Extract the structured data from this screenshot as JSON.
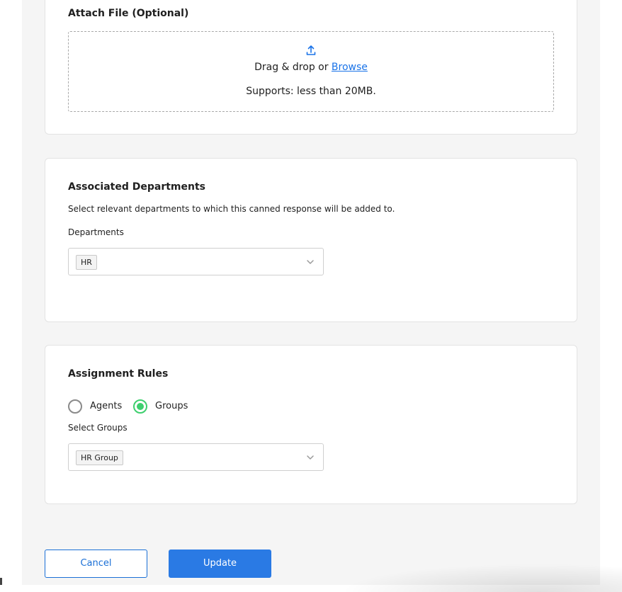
{
  "attach": {
    "title": "Attach File (Optional)",
    "drag_text": "Drag & drop or ",
    "browse_label": "Browse",
    "supports_text": "Supports: less than 20MB.",
    "icon": "upload-icon"
  },
  "departments": {
    "title": "Associated Departments",
    "description": "Select relevant departments to which this canned response will be added to.",
    "field_label": "Departments",
    "selected": [
      "HR"
    ]
  },
  "assignment": {
    "title": "Assignment Rules",
    "options": [
      {
        "label": "Agents",
        "checked": false
      },
      {
        "label": "Groups",
        "checked": true
      }
    ],
    "field_label": "Select Groups",
    "selected": [
      "HR Group"
    ]
  },
  "actions": {
    "cancel_label": "Cancel",
    "update_label": "Update"
  },
  "colors": {
    "primary": "#2a7ae4",
    "link": "#1a73e8",
    "radio_checked": "#3ecf6e"
  }
}
